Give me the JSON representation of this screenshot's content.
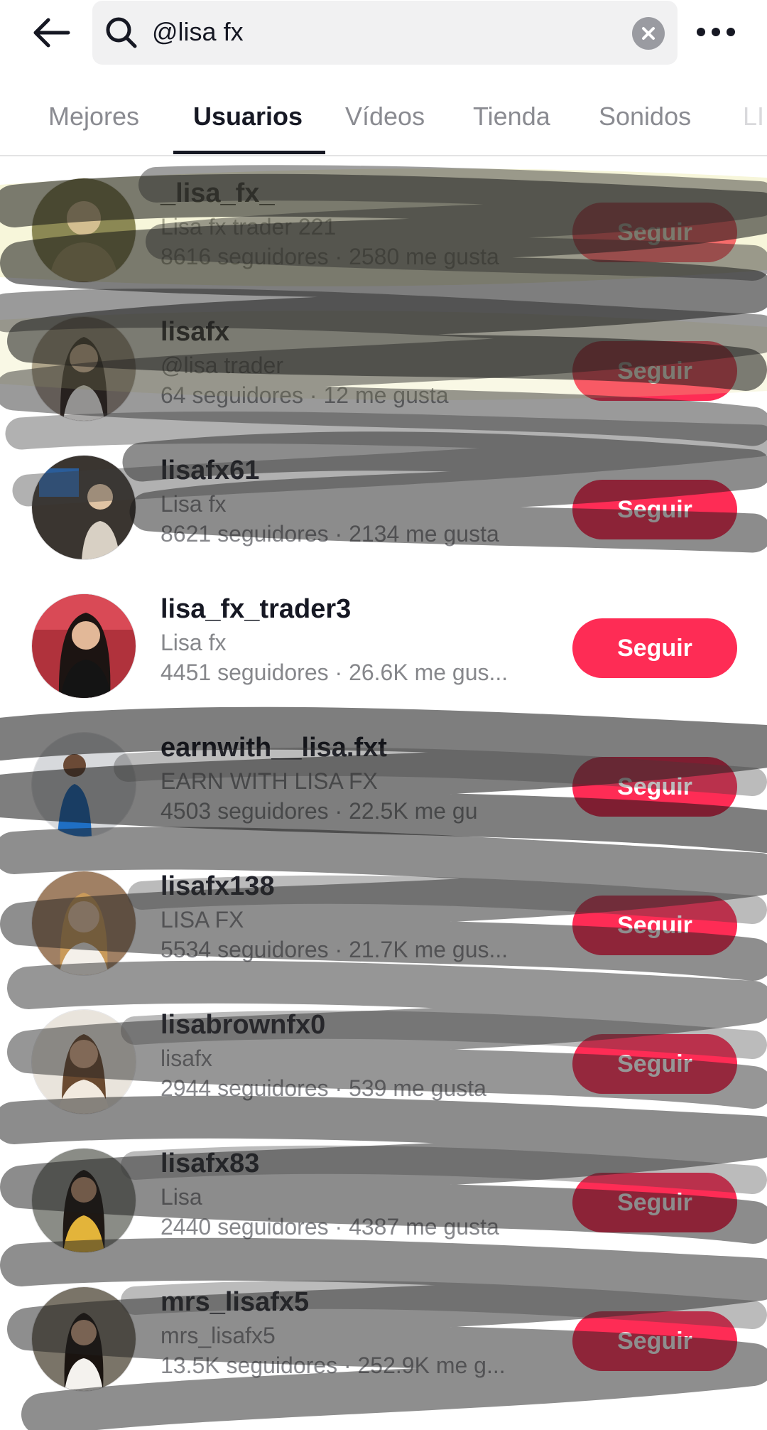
{
  "search": {
    "query": "@lisa fx"
  },
  "tabs": [
    {
      "label": "Mejores"
    },
    {
      "label": "Usuarios"
    },
    {
      "label": "Vídeos"
    },
    {
      "label": "Tienda"
    },
    {
      "label": "Sonidos"
    },
    {
      "label": "LI"
    }
  ],
  "users": [
    {
      "username": "_lisa_fx_",
      "nickname": "Lisa fx trader 221",
      "stats": "8616 seguidores · 2580 me gusta",
      "button": "Seguir",
      "avatar_color": "#5a5632"
    },
    {
      "username": "lisafx",
      "nickname": "@lisa trader",
      "stats": "64 seguidores · 12 me gusta",
      "button": "Seguir",
      "avatar_color": "#9b8f86"
    },
    {
      "username": "lisafx61",
      "nickname": "Lisa fx",
      "stats": "8621 seguidores · 2134 me gusta",
      "button": "Seguir",
      "avatar_color": "#3a3530"
    },
    {
      "username": "lisa_fx_trader3",
      "nickname": "Lisa fx",
      "stats": "4451 seguidores · 26.6K me gus...",
      "button": "Seguir",
      "avatar_color": "#b0323c"
    },
    {
      "username": "earnwith__lisa.fxt",
      "nickname": "EARN WITH LISA FX",
      "stats": "4503 seguidores · 22.5K me gu",
      "button": "Seguir",
      "avatar_color": "#6e7580"
    },
    {
      "username": "lisafx138",
      "nickname": "LISA FX",
      "stats": "5534 seguidores · 21.7K me gus...",
      "button": "Seguir",
      "avatar_color": "#a08064"
    },
    {
      "username": "lisabrownfx0",
      "nickname": "lisafx",
      "stats": "2944 seguidores · 539 me gusta",
      "button": "Seguir",
      "avatar_color": "#d8c6b0"
    },
    {
      "username": "lisafx83",
      "nickname": "Lisa",
      "stats": "2440 seguidores · 4387 me gusta",
      "button": "Seguir",
      "avatar_color": "#6a6a62"
    },
    {
      "username": "mrs_lisafx5",
      "nickname": "mrs_lisafx5",
      "stats": "13.5K seguidores · 252.9K me g...",
      "button": "Seguir",
      "avatar_color": "#7a7468"
    }
  ],
  "colors": {
    "accent": "#fe2c55",
    "text_primary": "#161823",
    "text_secondary": "#86878b",
    "search_bg": "#f1f1f2"
  }
}
